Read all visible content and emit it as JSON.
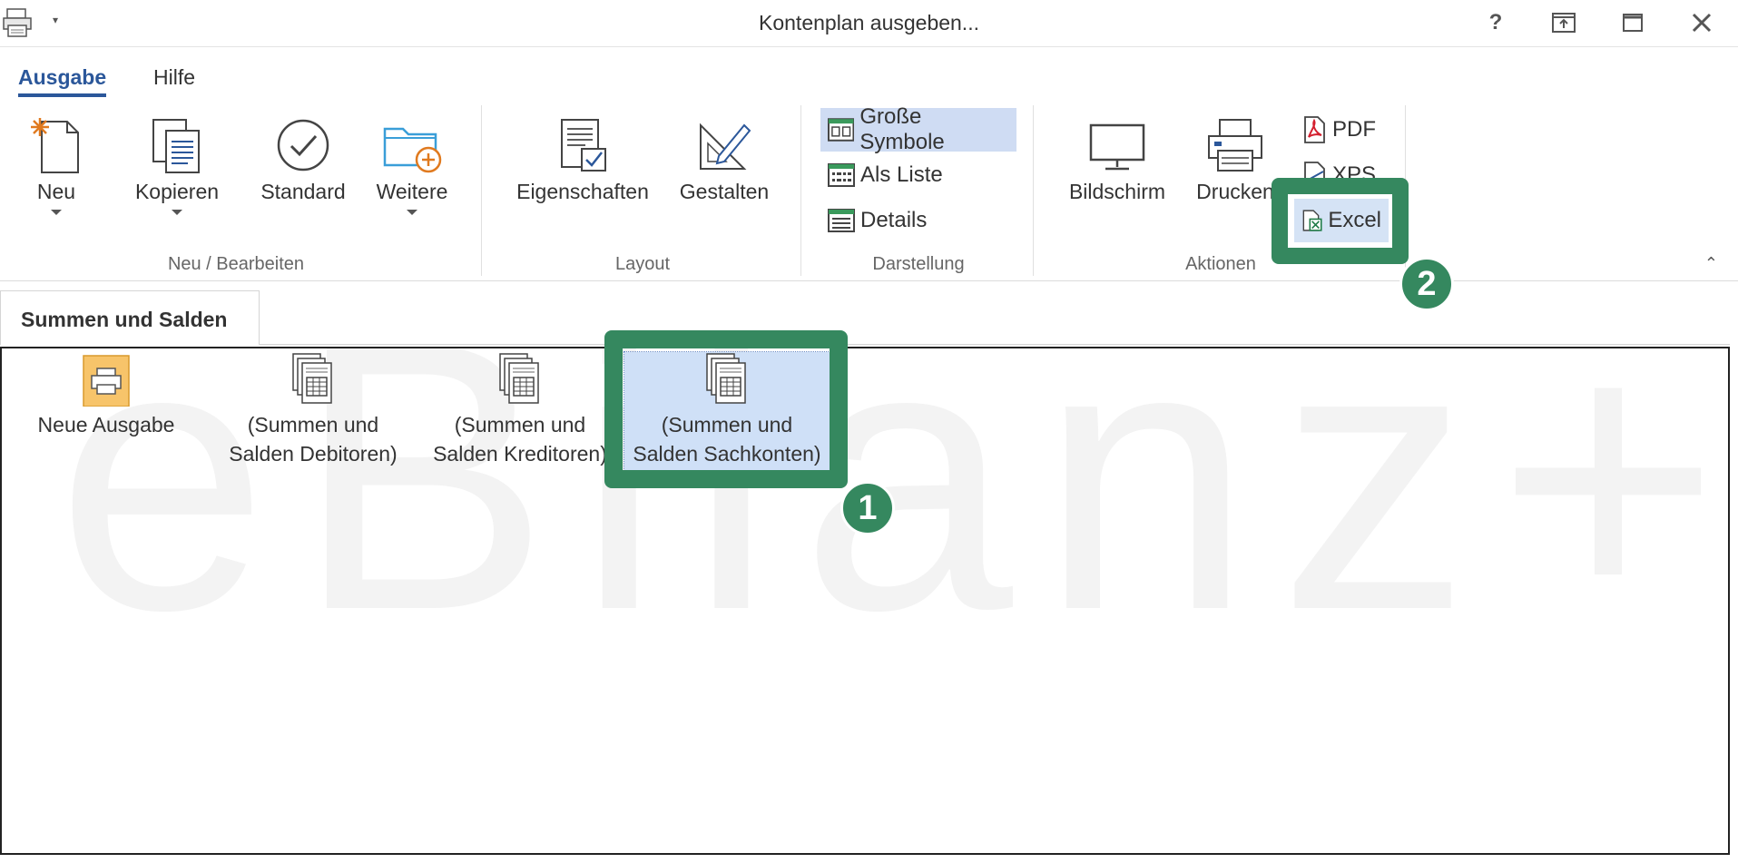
{
  "window": {
    "title": "Kontenplan ausgeben..."
  },
  "ribbon_tabs": [
    {
      "label": "Ausgabe",
      "active": true
    },
    {
      "label": "Hilfe",
      "active": false
    }
  ],
  "groups": {
    "neu_bearbeiten": {
      "label": "Neu / Bearbeiten",
      "buttons": {
        "neu": "Neu",
        "kopieren": "Kopieren",
        "standard": "Standard",
        "weitere": "Weitere"
      }
    },
    "layout": {
      "label": "Layout",
      "buttons": {
        "eigenschaften": "Eigenschaften",
        "gestalten": "Gestalten"
      }
    },
    "darstellung": {
      "label": "Darstellung",
      "buttons": {
        "grosse_symbole": "Große Symbole",
        "als_liste": "Als Liste",
        "details": "Details"
      }
    },
    "aktionen": {
      "label": "Aktionen",
      "buttons": {
        "bildschirm": "Bildschirm",
        "drucken": "Drucken",
        "pdf": "PDF",
        "xps": "XPS",
        "excel": "Excel"
      }
    }
  },
  "document_tab": "Summen und Salden",
  "watermark": "eBilanz+",
  "items": [
    {
      "line1": "Neue Ausgabe",
      "line2": ""
    },
    {
      "line1": "(Summen und",
      "line2": "Salden Debitoren)"
    },
    {
      "line1": "(Summen und",
      "line2": "Salden Kreditoren)"
    },
    {
      "line1": "(Summen und",
      "line2": "Salden Sachkonten)"
    }
  ],
  "annotations": {
    "badge1": "1",
    "badge2": "2"
  },
  "colors": {
    "accent": "#2b579a",
    "annotation": "#35885f",
    "selection": "#cfe0f7"
  }
}
